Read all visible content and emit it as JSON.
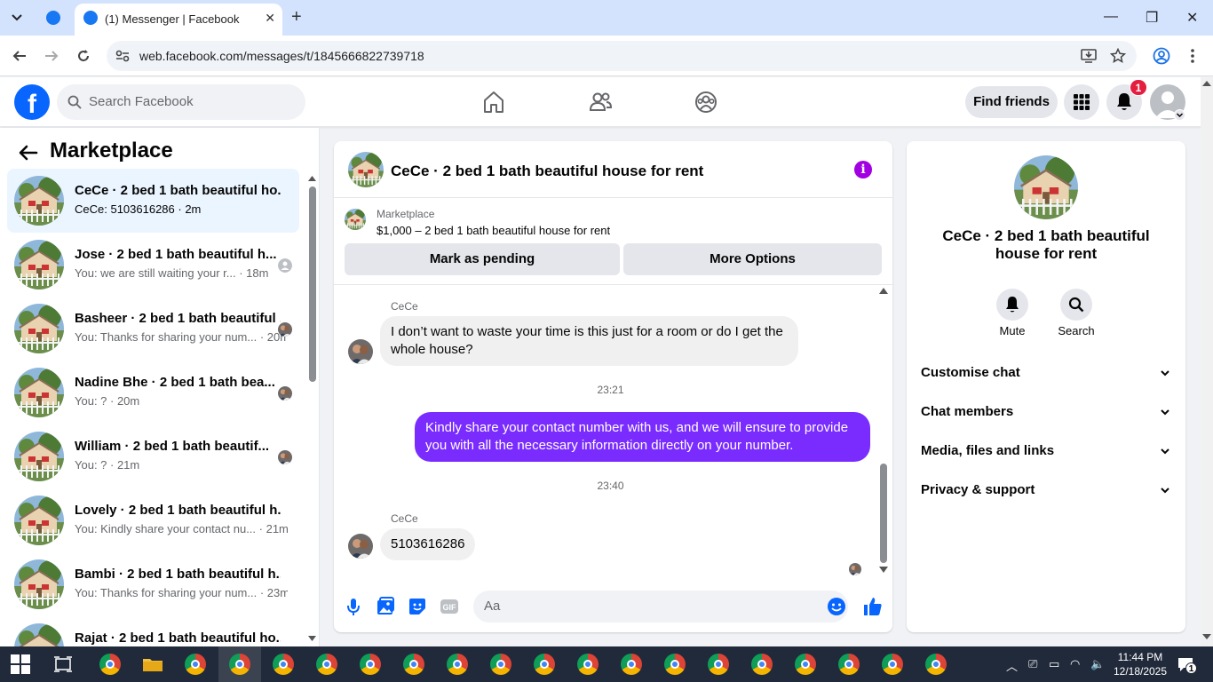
{
  "browser": {
    "tab_title": "(1) Messenger | Facebook",
    "url": "web.facebook.com/messages/t/1845666822739718"
  },
  "fb_header": {
    "search_placeholder": "Search Facebook",
    "find_friends_label": "Find friends",
    "notification_count": "1"
  },
  "sidebar": {
    "title": "Marketplace",
    "conversations": [
      {
        "name": "CeCe · 2 bed 1 bath beautiful ho...",
        "preview": "CeCe: 5103616286 · 2m",
        "active": true
      },
      {
        "name": "Jose · 2 bed 1 bath beautiful h...",
        "preview": "You: we are still waiting your r... · 18m"
      },
      {
        "name": "Basheer · 2 bed 1 bath beautiful ...",
        "preview": "You: Thanks for sharing your num... · 20m"
      },
      {
        "name": "Nadine Bhe · 2 bed 1 bath bea...",
        "preview": "You: ? · 20m"
      },
      {
        "name": "William · 2 bed 1 bath beautif...",
        "preview": "You: ? · 21m"
      },
      {
        "name": "Lovely · 2 bed 1 bath beautiful h...",
        "preview": "You: Kindly share your contact nu... · 21m"
      },
      {
        "name": "Bambi · 2 bed 1 bath beautiful h...",
        "preview": "You: Thanks for sharing your num... · 23m"
      },
      {
        "name": "Rajat · 2 bed 1 bath beautiful ho...",
        "preview": ""
      }
    ]
  },
  "chat": {
    "title": "CeCe · 2 bed 1 bath beautiful house for rent",
    "marketplace_label": "Marketplace",
    "listing": "$1,000 – 2 bed 1 bath beautiful house for rent",
    "mark_pending_label": "Mark as pending",
    "more_options_label": "More Options",
    "messages": [
      {
        "sender": "CeCe",
        "text": "I don’t want to waste your time is this just for a room or do I get the whole house?"
      },
      {
        "timestamp": "23:21"
      },
      {
        "sender": "You",
        "text": "Kindly share your contact number with us, and we will ensure to provide you with all the necessary information directly on your number."
      },
      {
        "timestamp": "23:40"
      },
      {
        "sender": "CeCe",
        "text": "5103616286"
      }
    ],
    "composer_placeholder": "Aa"
  },
  "details": {
    "title": "CeCe · 2 bed 1 bath beautiful house for rent",
    "mute_label": "Mute",
    "search_label": "Search",
    "sections": [
      "Customise chat",
      "Chat members",
      "Media, files and links",
      "Privacy & support"
    ]
  },
  "taskbar": {
    "time": "11:44 PM",
    "date": "12/18/2025",
    "notification_count": "1"
  },
  "colors": {
    "fb_blue": "#0866ff",
    "outgoing_bubble": "#7a2cff",
    "info_purple": "#a200e2"
  }
}
